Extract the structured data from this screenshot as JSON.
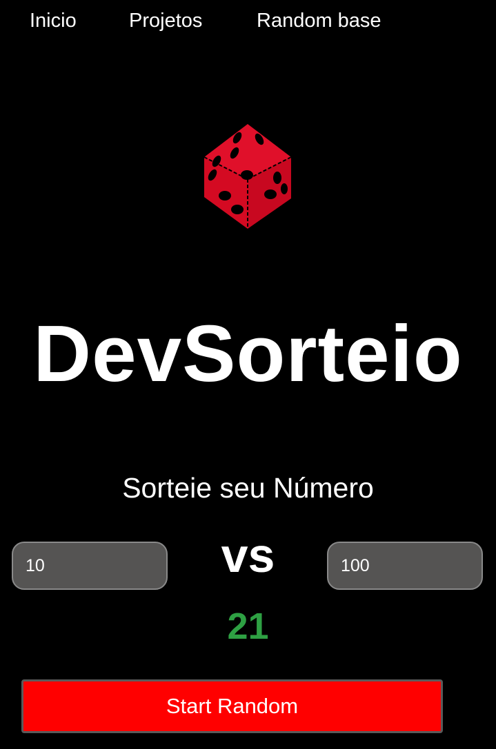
{
  "nav": {
    "items": [
      {
        "label": "Inicio"
      },
      {
        "label": "Projetos"
      },
      {
        "label": "Random base"
      }
    ]
  },
  "hero": {
    "icon": "dice-icon",
    "title": "DevSorteio",
    "subtitle": "Sorteie seu Número"
  },
  "range": {
    "min_value": "10",
    "max_value": "100",
    "separator": "vs"
  },
  "result": {
    "value": "21"
  },
  "actions": {
    "start_label": "Start Random"
  },
  "colors": {
    "background": "#000000",
    "accent": "#ff0000",
    "dice": "#e0102a",
    "result": "#2ea043",
    "input_bg": "#555453"
  }
}
